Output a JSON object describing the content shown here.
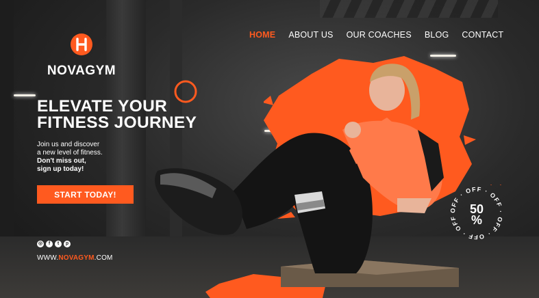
{
  "brand": {
    "name": "NOVAGYM",
    "logo_letter": "H"
  },
  "nav": {
    "items": [
      {
        "label": "HOME",
        "active": true
      },
      {
        "label": "ABOUT US",
        "active": false
      },
      {
        "label": "OUR COACHES",
        "active": false
      },
      {
        "label": "BLOG",
        "active": false
      },
      {
        "label": "CONTACT",
        "active": false
      }
    ]
  },
  "hero": {
    "headline_line1": "ELEVATE YOUR",
    "headline_line2": "FITNESS JOURNEY",
    "sub_line1": "Join us and discover",
    "sub_line2": "a new level of fitness.",
    "sub_bold1": "Don't miss out,",
    "sub_bold2": "sign up today!",
    "cta_label": "START TODAY!"
  },
  "socials": [
    {
      "icon": "instagram-icon",
      "glyph": "◎"
    },
    {
      "icon": "facebook-icon",
      "glyph": "f"
    },
    {
      "icon": "twitter-icon",
      "glyph": "t"
    },
    {
      "icon": "pinterest-icon",
      "glyph": "p"
    }
  ],
  "website": {
    "prefix": "WWW.",
    "highlight": "NOVAGYM",
    "suffix": ".COM"
  },
  "badge": {
    "percent": "50\n%",
    "ring_text": "OFF · OFF · OFF · OFF · OFF · OFF ·"
  },
  "colors": {
    "accent": "#ff5a1f",
    "background": "#1a1a1a",
    "text": "#ffffff"
  }
}
